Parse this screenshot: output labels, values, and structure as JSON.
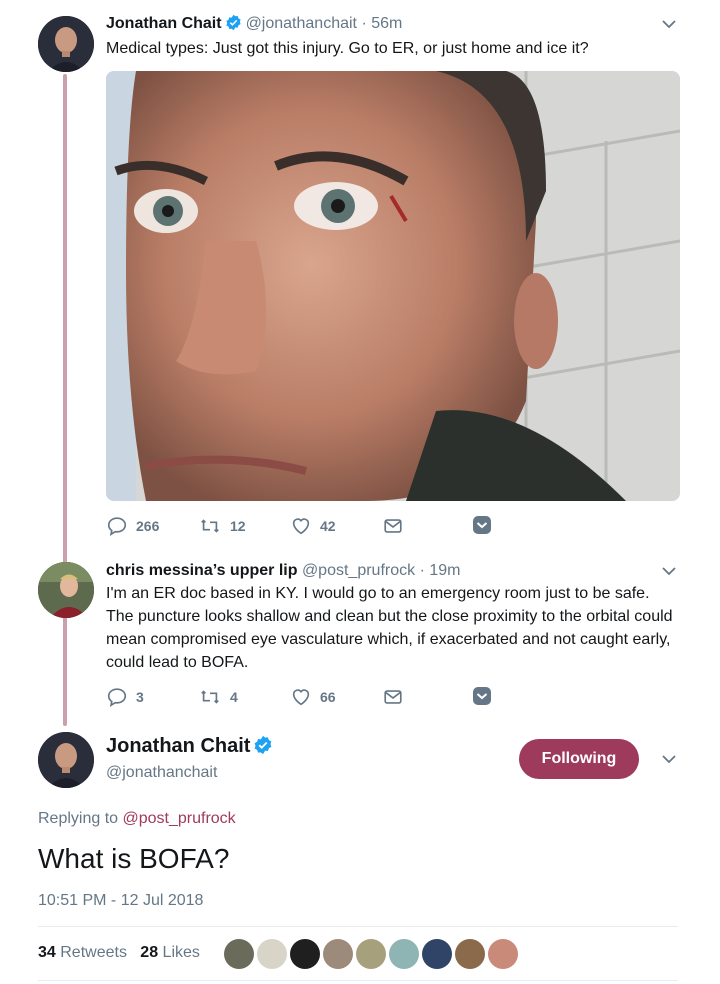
{
  "tweet1": {
    "name": "Jonathan Chait",
    "handle": "@jonathanchait",
    "time": "· 56m",
    "text": "Medical types: Just got this injury. Go to ER, or just home and ice it?",
    "actions": {
      "replies": "266",
      "retweets": "12",
      "likes": "42"
    },
    "photo_icon": "face-photo"
  },
  "tweet2": {
    "name": "chris messina’s upper lip",
    "handle": "@post_prufrock",
    "time": "· 19m",
    "text": "I'm an ER doc based in KY. I would go to an emergency room just to be safe. The puncture looks shallow and clean but the close proximity to the orbital could mean compromised eye vasculature which, if exacerbated and not caught early, could lead to BOFA.",
    "actions": {
      "replies": "3",
      "retweets": "4",
      "likes": "66"
    }
  },
  "main": {
    "name": "Jonathan Chait",
    "handle": "@jonathanchait",
    "follow_label": "Following",
    "replying_prefix": "Replying to",
    "replying_to": "@post_prufrock",
    "text": "What is BOFA?",
    "timestamp": "10:51 PM - 12 Jul 2018",
    "retweets_count": "34",
    "retweets_label": "Retweets",
    "likes_count": "28",
    "likes_label": "Likes"
  },
  "colors": {
    "accent": "#9e3b5d",
    "thread_line": "#c9a0ab",
    "verified": "#1da1f2",
    "muted": "#657786"
  }
}
